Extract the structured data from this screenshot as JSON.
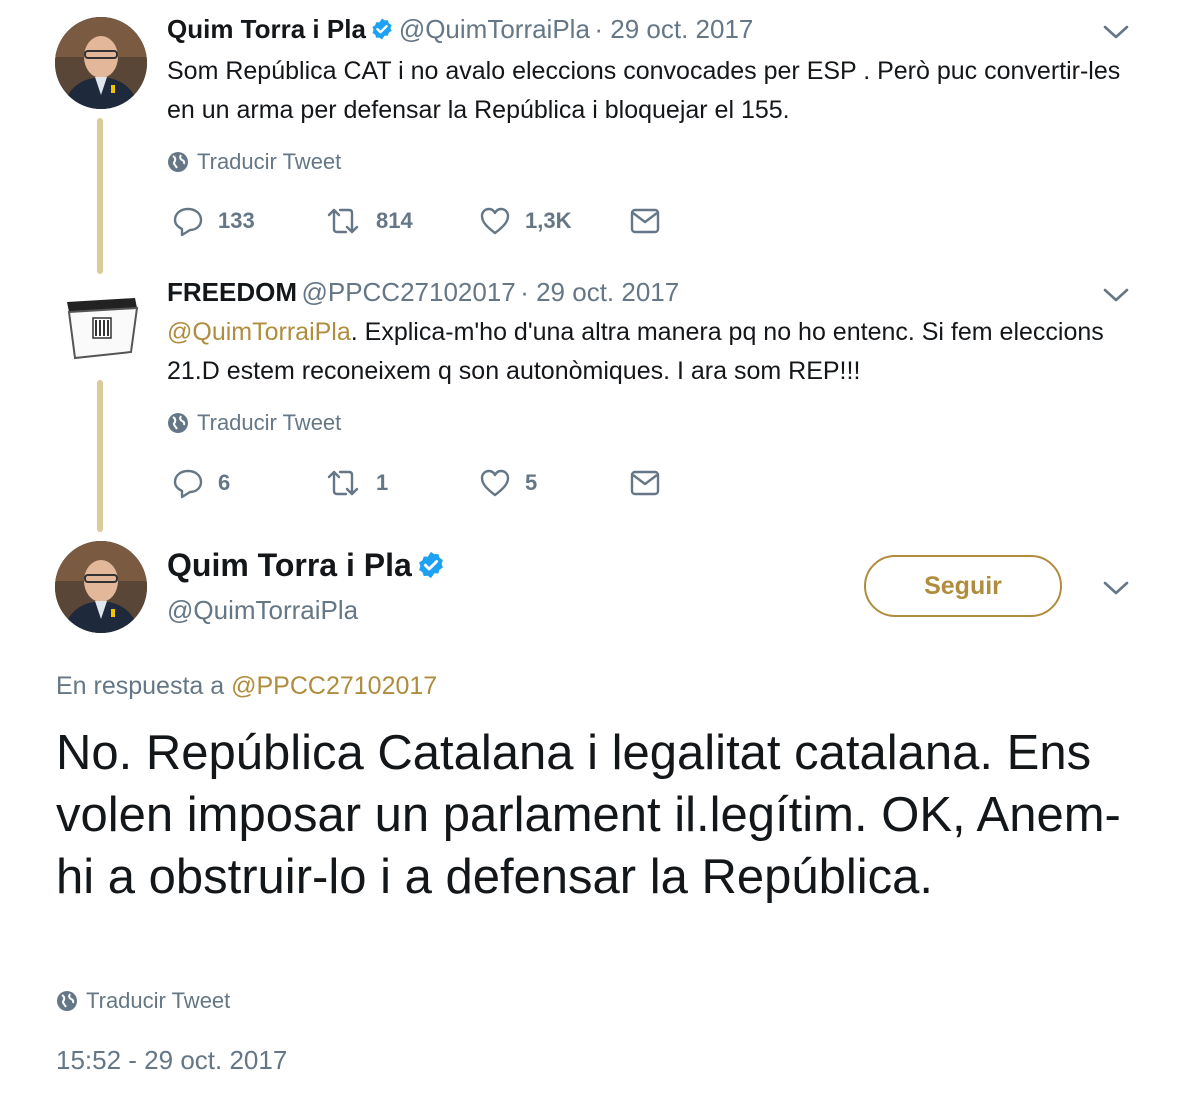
{
  "tweet1": {
    "name": "Quim Torra i Pla",
    "handle": "@QuimTorraiPla",
    "date": "· 29 oct. 2017",
    "text": "Som República CAT i no avalo eleccions convocades per ESP . Però puc convertir-les en un arma per defensar la República i bloquejar el 155.",
    "translate": "Traducir Tweet",
    "replies": "133",
    "retweets": "814",
    "likes": "1,3K"
  },
  "tweet2": {
    "name": "FREEDOM",
    "handle": "@PPCC27102017",
    "date": "· 29 oct. 2017",
    "mention": "@QuimTorraiPla",
    "text": ". Explica-m'ho d'una altra manera pq no ho entenc. Si fem eleccions 21.D estem reconeixem q son autonòmiques. I ara som REP!!!",
    "translate": "Traducir Tweet",
    "replies": "6",
    "retweets": "1",
    "likes": "5"
  },
  "main": {
    "name": "Quim Torra i Pla",
    "handle": "@QuimTorraiPla",
    "follow_label": "Seguir",
    "reply_prefix": "En respuesta a",
    "reply_to": "@PPCC27102017",
    "text": "No. República Catalana i legalitat catalana. Ens volen imposar un parlament il.legítim. OK, Anem-hi a obstruir-lo i a defensar la República.",
    "translate": "Traducir Tweet",
    "timestamp": "15:52 - 29 oct. 2017"
  },
  "colors": {
    "accent": "#b08d3e",
    "verified": "#1da1f2",
    "muted": "#657786",
    "thread_line": "#d9cc9a"
  },
  "icons": [
    "verified-badge-icon",
    "chevron-down-icon",
    "globe-icon",
    "reply-icon",
    "retweet-icon",
    "like-icon",
    "message-icon",
    "ballot-box-icon"
  ]
}
